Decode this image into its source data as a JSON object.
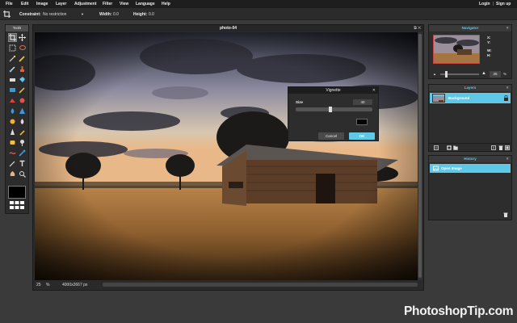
{
  "menubar": {
    "items": [
      "File",
      "Edit",
      "Image",
      "Layer",
      "Adjustment",
      "Filter",
      "View",
      "Language",
      "Help"
    ],
    "login": "Login",
    "signup": "Sign up"
  },
  "options": {
    "constraint_label": "Constraint:",
    "constraint_value": "No restriction",
    "width_label": "Width:",
    "width_value": "0.0",
    "height_label": "Height:",
    "height_value": "0.0"
  },
  "tools": {
    "title": "Tools",
    "icons": [
      "crop-icon",
      "move-icon",
      "marquee-icon",
      "lasso-icon",
      "magic-wand-icon",
      "pencil-icon",
      "brush-icon",
      "clone-stamp-icon",
      "eraser-icon",
      "bucket-icon",
      "gradient-icon",
      "color-replace-icon",
      "drawing-icon",
      "red-eye-icon",
      "spot-heal-icon",
      "bloat-icon",
      "pinch-icon",
      "blur-icon",
      "sharpen-icon",
      "smudge-icon",
      "sponge-icon",
      "dodge-icon",
      "burn-icon",
      "eyedropper-icon",
      "hand-icon",
      "type-icon",
      "zoom-icon",
      "hand-pan-icon"
    ]
  },
  "document": {
    "title": "photo-04",
    "zoom": "25",
    "zoom_unit": "%",
    "size": "4000x2667 px"
  },
  "vignette": {
    "title": "Vignette",
    "slider_label": "Size",
    "slider_value": "40",
    "slider_fraction": 0.45,
    "cancel": "Cancel",
    "ok": "OK"
  },
  "navigator": {
    "title": "Navigator",
    "x_label": "X:",
    "y_label": "Y:",
    "w_label": "W:",
    "h_label": "H:",
    "zoom_value": "25",
    "zoom_fraction": 0.12
  },
  "layers": {
    "title": "Layers",
    "items": [
      {
        "name": "Background"
      }
    ]
  },
  "history": {
    "title": "History",
    "items": [
      {
        "name": "Open Image"
      }
    ]
  },
  "watermark": "PhotoshopTip.com",
  "colors": {
    "accent": "#5fc8e6",
    "panel_bg": "#2d2d2d",
    "workspace_bg": "#3a3a3a"
  }
}
